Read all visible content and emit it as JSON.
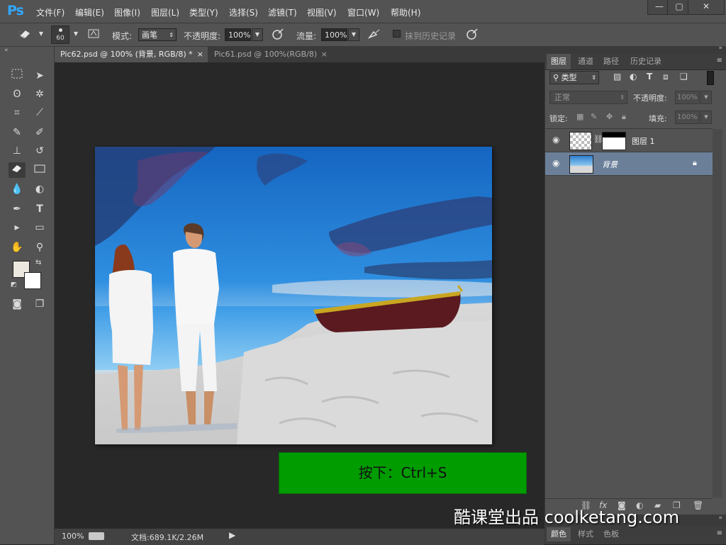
{
  "app": {
    "logo": "Ps"
  },
  "menubar": {
    "items": [
      "文件(F)",
      "编辑(E)",
      "图像(I)",
      "图层(L)",
      "类型(Y)",
      "选择(S)",
      "滤镜(T)",
      "视图(V)",
      "窗口(W)",
      "帮助(H)"
    ],
    "window_buttons": [
      "—",
      "▢",
      "✕"
    ]
  },
  "optbar": {
    "brush_size": "60",
    "mode_label": "模式:",
    "mode_value": "画笔",
    "opacity_label": "不透明度:",
    "opacity_value": "100%",
    "flow_label": "流量:",
    "flow_value": "100%",
    "erase_history_label": "抹到历史记录"
  },
  "tabs": [
    {
      "label": "Pic62.psd @ 100% (背景, RGB/8) *",
      "active": true,
      "close": "×"
    },
    {
      "label": "Pic61.psd @ 100%(RGB/8)",
      "active": false,
      "close": "×"
    }
  ],
  "statusbar": {
    "zoom": "100%",
    "doc_info": "文档:689.1K/2.26M"
  },
  "panel": {
    "tabs": [
      "图层",
      "通道",
      "路径",
      "历史记录"
    ],
    "filter_kind": "类型",
    "blend_mode": "正常",
    "opacity_label": "不透明度:",
    "opacity_value": "100%",
    "lock_label": "锁定:",
    "fill_label": "填充:",
    "fill_value": "100%",
    "layers": [
      {
        "name": "图层 1",
        "selected": false
      },
      {
        "name": "背景",
        "selected": true
      }
    ],
    "bottom_tabs": [
      "颜色",
      "样式",
      "色板"
    ]
  },
  "instruction": {
    "text": "按下：Ctrl+S"
  },
  "watermark": {
    "text": "酷课堂出品 coolketang.com"
  },
  "colors": {
    "accent": "#009c00",
    "panel": "#535353",
    "canvas_bg": "#282828",
    "selected_layer": "#6b7f99"
  }
}
